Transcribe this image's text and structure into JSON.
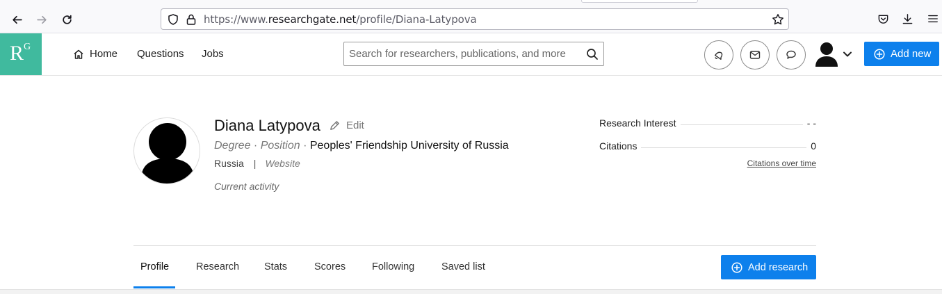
{
  "browser": {
    "url_prefix": "https://www.",
    "url_domain": "researchgate.net",
    "url_path": "/profile/Diana-Latypova"
  },
  "header": {
    "logo_main": "R",
    "logo_sup": "G",
    "nav": [
      {
        "label": "Home",
        "icon": "home-icon"
      },
      {
        "label": "Questions"
      },
      {
        "label": "Jobs"
      }
    ],
    "search_placeholder": "Search for researchers, publications, and more",
    "add_new_label": "Add new",
    "accent_color": "#0d80ec",
    "logo_color": "#40ba9e"
  },
  "profile": {
    "name": "Diana Latypova",
    "edit_label": "Edit",
    "degree": "Degree",
    "position": "Position",
    "institution": "Peoples' Friendship University of Russia",
    "country": "Russia",
    "website": "Website",
    "current_activity": "Current activity"
  },
  "stats": {
    "research_interest_label": "Research Interest",
    "research_interest_value": "- -",
    "citations_label": "Citations",
    "citations_value": "0",
    "citations_over_time": "Citations over time"
  },
  "tabs": [
    {
      "label": "Profile",
      "active": true
    },
    {
      "label": "Research"
    },
    {
      "label": "Stats"
    },
    {
      "label": "Scores"
    },
    {
      "label": "Following"
    },
    {
      "label": "Saved list"
    }
  ],
  "add_research_label": "Add research"
}
